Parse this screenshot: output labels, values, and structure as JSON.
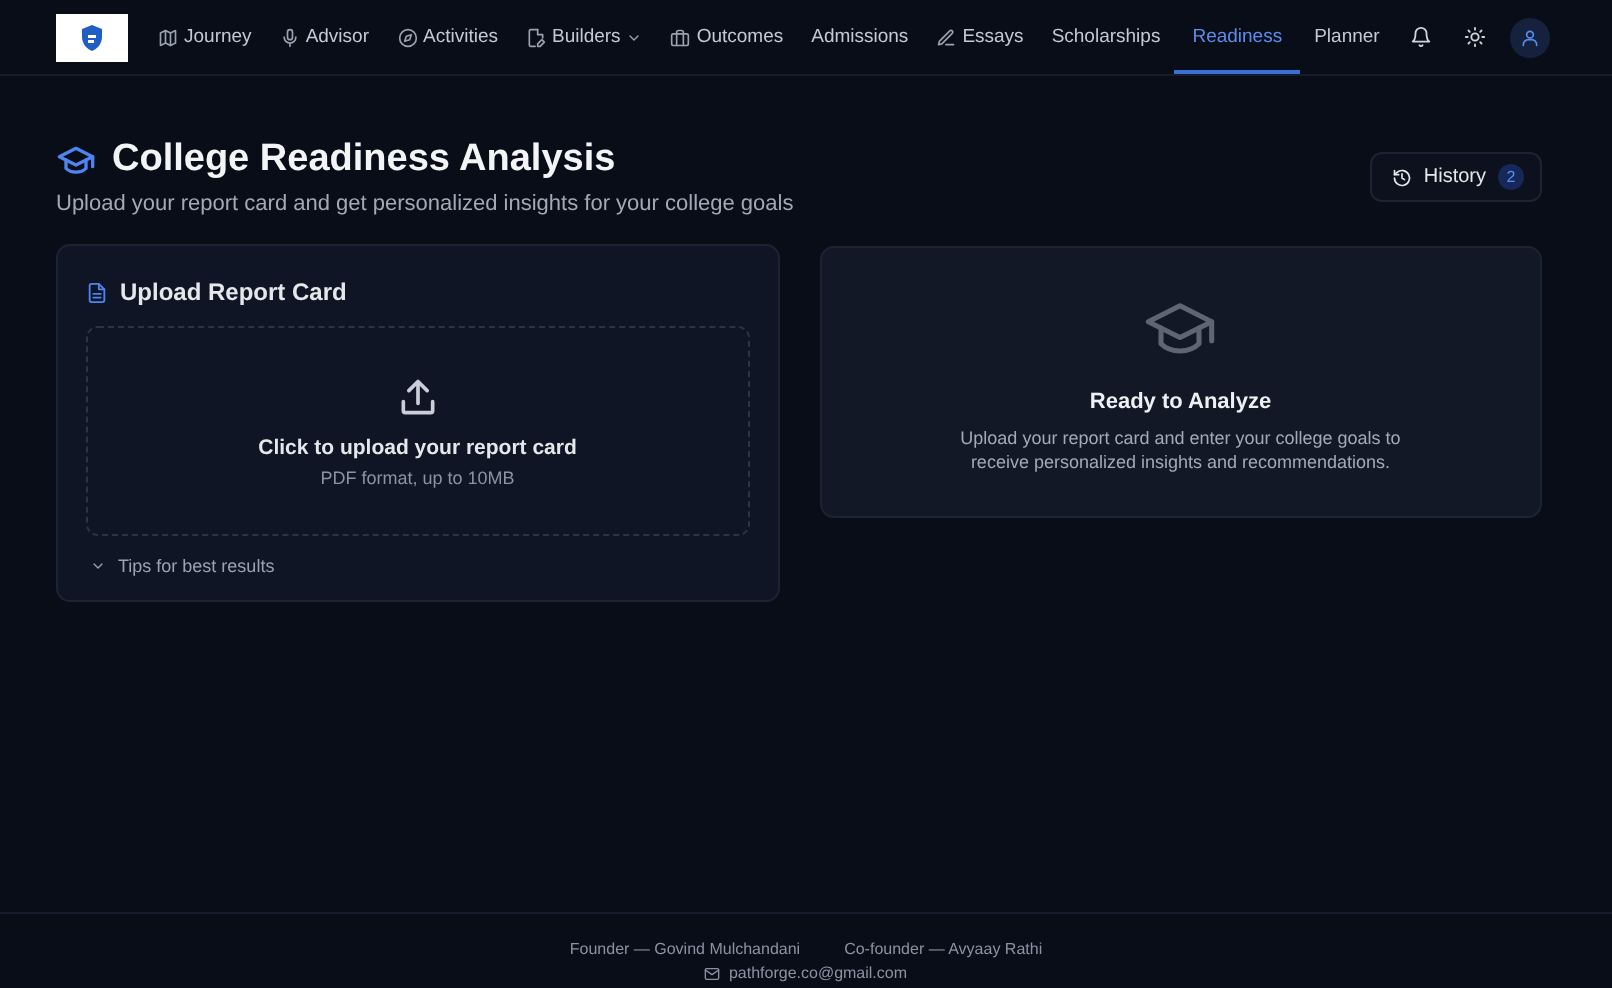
{
  "nav": {
    "items": [
      {
        "label": "Journey",
        "kind": "map",
        "selected": false,
        "dropdown": false
      },
      {
        "label": "Advisor",
        "kind": "mic",
        "selected": false,
        "dropdown": false
      },
      {
        "label": "Activities",
        "kind": "compass",
        "selected": false,
        "dropdown": false
      },
      {
        "label": "Builders",
        "kind": "builder",
        "selected": false,
        "dropdown": true
      },
      {
        "label": "Outcomes",
        "kind": "briefcase",
        "selected": false,
        "dropdown": false
      },
      {
        "label": "Admissions",
        "kind": "plain",
        "selected": false,
        "dropdown": false
      },
      {
        "label": "Essays",
        "kind": "pen",
        "selected": false,
        "dropdown": false
      },
      {
        "label": "Scholarships",
        "kind": "plain",
        "selected": false,
        "dropdown": false
      },
      {
        "label": "Readiness",
        "kind": "plain",
        "selected": true,
        "dropdown": false
      },
      {
        "label": "Planner",
        "kind": "plain",
        "selected": false,
        "dropdown": false
      }
    ]
  },
  "header": {
    "title": "College Readiness Analysis",
    "subtitle": "Upload your report card and get personalized insights for your college goals",
    "history": {
      "label": "History",
      "count": "2"
    }
  },
  "upload_card": {
    "title": "Upload Report Card",
    "dropzone_title": "Click to upload your report card",
    "dropzone_hint": "PDF format, up to 10MB",
    "tips": {
      "label": "Tips for best results",
      "expanded": false
    }
  },
  "analyze_card": {
    "title": "Ready to Analyze",
    "text": "Upload your report card and enter your college goals to receive personalized insights and recommendations."
  },
  "footer": {
    "credits": [
      "Founder — Govind Mulchandani",
      "Co-founder — Avyaay Rathi"
    ],
    "email": "pathforge.co@gmail.com"
  }
}
